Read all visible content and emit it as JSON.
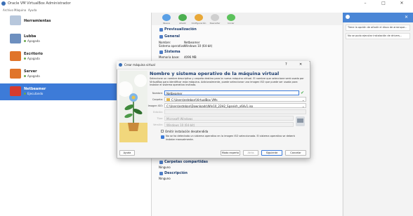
{
  "window": {
    "title": "Oracle VM VirtualBox Administrador",
    "minimize": "–",
    "maximize": "□",
    "close": "✕"
  },
  "menu": [
    "Archivo",
    "Máquina",
    "Ayuda"
  ],
  "sidebar": {
    "tools_label": "Herramientas",
    "vms": [
      {
        "name": "Lubba",
        "state": "Apagada",
        "color": "#6d8fbf",
        "selected": false
      },
      {
        "name": "Escritorio",
        "state": "Apagada",
        "color": "#e0742a",
        "selected": false
      },
      {
        "name": "Server",
        "state": "Apagada",
        "color": "#e0742a",
        "selected": false
      },
      {
        "name": "Netbeamer",
        "state": "Ejecutando",
        "color": "#d63b2f",
        "selected": true
      }
    ]
  },
  "toolbar": [
    {
      "label": "Nueva",
      "icon": "new-icon",
      "color": "#5aa0e6"
    },
    {
      "label": "Añadir",
      "icon": "add-icon",
      "color": "#4caf50"
    },
    {
      "label": "Configuración",
      "icon": "settings-icon",
      "color": "#e8a838"
    },
    {
      "label": "Descartar",
      "icon": "discard-icon",
      "color": "#cfcfcf"
    },
    {
      "label": "Iniciar",
      "icon": "start-icon",
      "color": "#5cc25c"
    }
  ],
  "details": {
    "preview_label": "Previsualización",
    "general": {
      "heading": "General",
      "rows": [
        {
          "k": "Nombre:",
          "v": "Netbeamer"
        },
        {
          "k": "Sistema operativo:",
          "v": "Windows 10 (64-bit)"
        }
      ]
    },
    "system": {
      "heading": "Sistema",
      "rows": [
        {
          "k": "Memoria base:",
          "v": "4096 MB"
        }
      ]
    },
    "shared": {
      "heading": "Carpetas compartidas",
      "none": "Ninguno"
    },
    "description": {
      "heading": "Descripción",
      "none": "Ninguno"
    }
  },
  "notifications": {
    "items": [
      "Tiene la opción de añadir el disco de arranque...",
      "No se pudo ejecutar instalación de drivers..."
    ]
  },
  "dialog": {
    "title": "Crear máquina virtual",
    "help": "?",
    "close": "✕",
    "heading": "Nombre y sistema operativo de la máquina virtual",
    "description": "Seleccione un nombre descriptivo y carpeta destino para la nueva máquina virtual. El nombre que seleccione será usado por VirtualBox para identificar esta máquina. Adicionalmente, puede seleccionar una imagen ISO que puede ser usada para instalar el sistema operativo invitado.",
    "fields": {
      "name_label": "Nombre:",
      "name_value": "Netbeamer",
      "folder_label": "Carpeta:",
      "folder_value": "C:\\Users\\esteban\\VirtualBox VMs",
      "iso_label": "Imagen ISO:",
      "iso_value": "C:\\Users\\esteban\\Downloads\\Win10_22H2_Spanish_x64v1.iso",
      "edition_label": "Edición:",
      "type_label": "Tipo:",
      "type_value": "Microsoft Windows",
      "version_label": "Versión:",
      "version_value": "Windows 10 (64-bit)"
    },
    "checkbox_unattended": "Omitir instalación desatendida",
    "note": "No se ha detectado un sistema operativo en la imagen ISO seleccionada. El sistema operativo se deberá instalar manualmente.",
    "buttons": {
      "help": "Ayuda",
      "expert": "Modo experto",
      "back": "Atrás",
      "next": "Siguiente",
      "cancel": "Cancelar"
    }
  }
}
